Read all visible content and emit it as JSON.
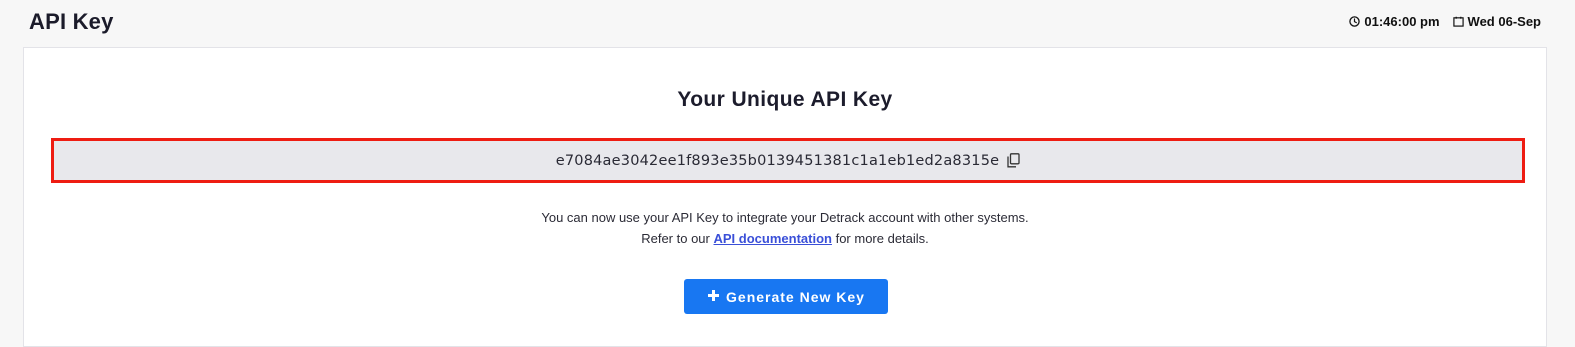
{
  "header": {
    "title": "API Key",
    "time": "01:46:00 pm",
    "date": "Wed 06-Sep",
    "time_icon": "clock-icon",
    "date_icon": "calendar-icon"
  },
  "card": {
    "title": "Your Unique API Key",
    "api_key": "e7084ae3042ee1f893e35b0139451381c1a1eb1ed2a8315e",
    "copy_icon": "copy-icon",
    "description_line1": "You can now use your API Key to integrate your Detrack account with other systems.",
    "description_prefix": "Refer to our",
    "doc_link": "API documentation",
    "description_suffix": "for more details.",
    "generate_button": "Generate New Key",
    "generate_icon": "plus-icon"
  },
  "colors": {
    "highlight_border": "#ee1c12",
    "button": "#1877f2",
    "link": "#3a4fd8"
  }
}
